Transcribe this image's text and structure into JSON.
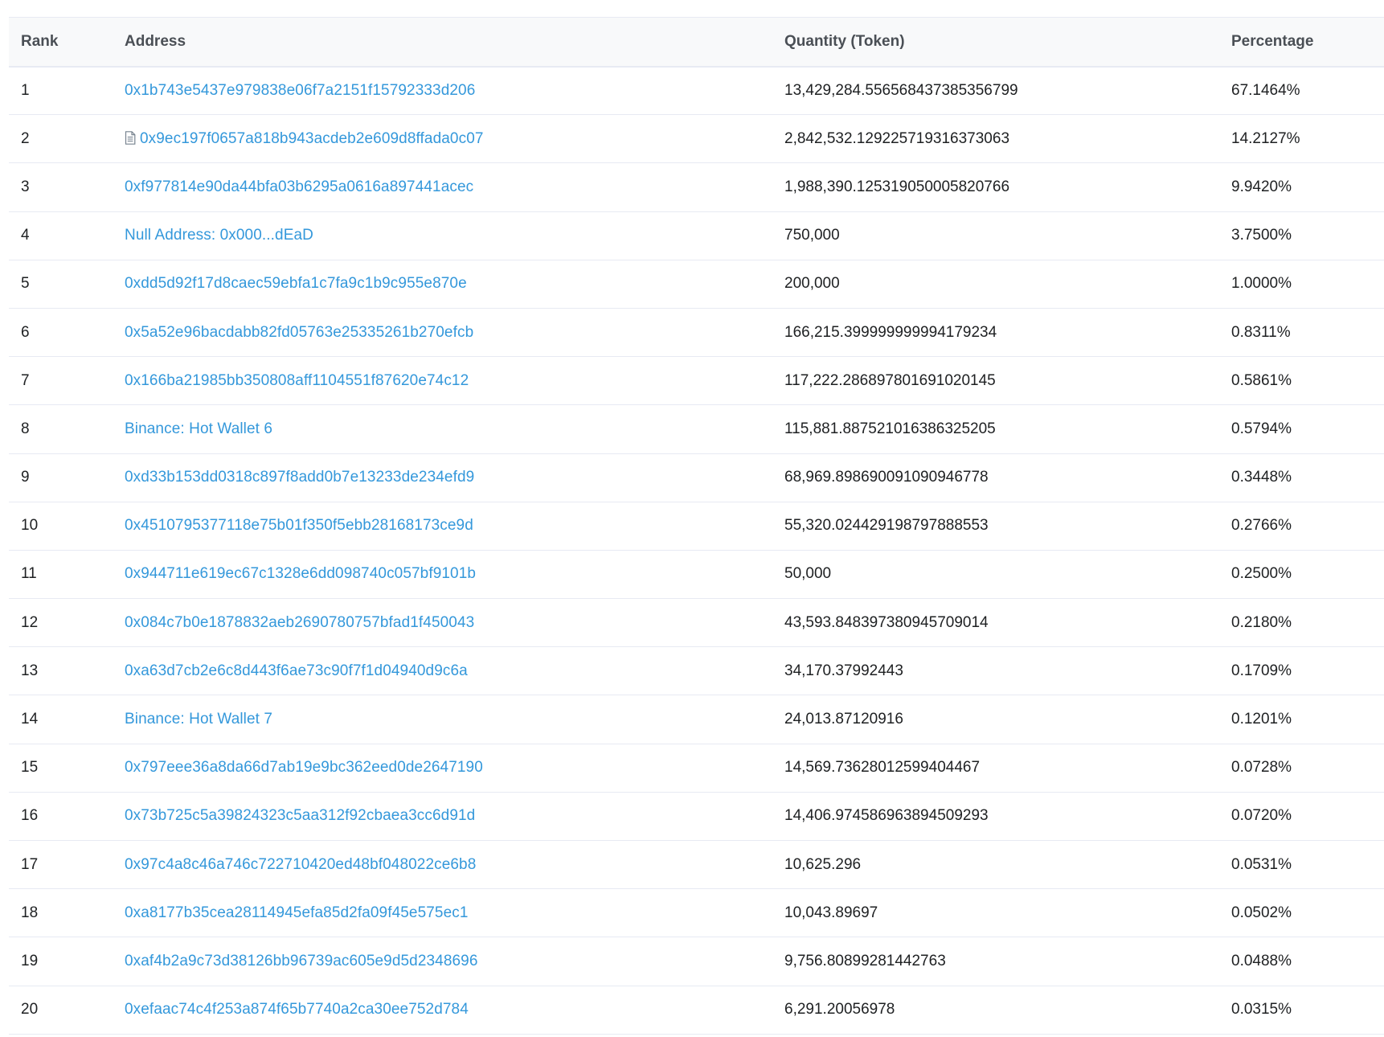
{
  "table": {
    "headers": {
      "rank": "Rank",
      "address": "Address",
      "quantity": "Quantity (Token)",
      "percentage": "Percentage"
    },
    "rows": [
      {
        "rank": "1",
        "address": "0x1b743e5437e979838e06f7a2151f15792333d206",
        "contract": false,
        "quantity": "13,429,284.556568437385356799",
        "percentage": "67.1464%"
      },
      {
        "rank": "2",
        "address": "0x9ec197f0657a818b943acdeb2e609d8ffada0c07",
        "contract": true,
        "quantity": "2,842,532.129225719316373063",
        "percentage": "14.2127%"
      },
      {
        "rank": "3",
        "address": "0xf977814e90da44bfa03b6295a0616a897441acec",
        "contract": false,
        "quantity": "1,988,390.125319050005820766",
        "percentage": "9.9420%"
      },
      {
        "rank": "4",
        "address": "Null Address: 0x000...dEaD",
        "contract": false,
        "quantity": "750,000",
        "percentage": "3.7500%"
      },
      {
        "rank": "5",
        "address": "0xdd5d92f17d8caec59ebfa1c7fa9c1b9c955e870e",
        "contract": false,
        "quantity": "200,000",
        "percentage": "1.0000%"
      },
      {
        "rank": "6",
        "address": "0x5a52e96bacdabb82fd05763e25335261b270efcb",
        "contract": false,
        "quantity": "166,215.399999999994179234",
        "percentage": "0.8311%"
      },
      {
        "rank": "7",
        "address": "0x166ba21985bb350808aff1104551f87620e74c12",
        "contract": false,
        "quantity": "117,222.286897801691020145",
        "percentage": "0.5861%"
      },
      {
        "rank": "8",
        "address": "Binance: Hot Wallet 6",
        "contract": false,
        "quantity": "115,881.887521016386325205",
        "percentage": "0.5794%"
      },
      {
        "rank": "9",
        "address": "0xd33b153dd0318c897f8add0b7e13233de234efd9",
        "contract": false,
        "quantity": "68,969.898690091090946778",
        "percentage": "0.3448%"
      },
      {
        "rank": "10",
        "address": "0x4510795377118e75b01f350f5ebb28168173ce9d",
        "contract": false,
        "quantity": "55,320.024429198797888553",
        "percentage": "0.2766%"
      },
      {
        "rank": "11",
        "address": "0x944711e619ec67c1328e6dd098740c057bf9101b",
        "contract": false,
        "quantity": "50,000",
        "percentage": "0.2500%"
      },
      {
        "rank": "12",
        "address": "0x084c7b0e1878832aeb2690780757bfad1f450043",
        "contract": false,
        "quantity": "43,593.848397380945709014",
        "percentage": "0.2180%"
      },
      {
        "rank": "13",
        "address": "0xa63d7cb2e6c8d443f6ae73c90f7f1d04940d9c6a",
        "contract": false,
        "quantity": "34,170.37992443",
        "percentage": "0.1709%"
      },
      {
        "rank": "14",
        "address": "Binance: Hot Wallet 7",
        "contract": false,
        "quantity": "24,013.87120916",
        "percentage": "0.1201%"
      },
      {
        "rank": "15",
        "address": "0x797eee36a8da66d7ab19e9bc362eed0de2647190",
        "contract": false,
        "quantity": "14,569.73628012599404467",
        "percentage": "0.0728%"
      },
      {
        "rank": "16",
        "address": "0x73b725c5a39824323c5aa312f92cbaea3cc6d91d",
        "contract": false,
        "quantity": "14,406.974586963894509293",
        "percentage": "0.0720%"
      },
      {
        "rank": "17",
        "address": "0x97c4a8c46a746c722710420ed48bf048022ce6b8",
        "contract": false,
        "quantity": "10,625.296",
        "percentage": "0.0531%"
      },
      {
        "rank": "18",
        "address": "0xa8177b35cea28114945efa85d2fa09f45e575ec1",
        "contract": false,
        "quantity": "10,043.89697",
        "percentage": "0.0502%"
      },
      {
        "rank": "19",
        "address": "0xaf4b2a9c73d38126bb96739ac605e9d5d2348696",
        "contract": false,
        "quantity": "9,756.80899281442763",
        "percentage": "0.0488%"
      },
      {
        "rank": "20",
        "address": "0xefaac74c4f253a874f65b7740a2ca30ee752d784",
        "contract": false,
        "quantity": "6,291.20056978",
        "percentage": "0.0315%"
      }
    ]
  },
  "colors": {
    "link": "#3498db",
    "text": "#1e2022",
    "header_text": "#4a4f55",
    "header_bg": "#f8f9fa",
    "border": "#e7eaf3"
  },
  "icons": {
    "contract": "document-icon"
  }
}
